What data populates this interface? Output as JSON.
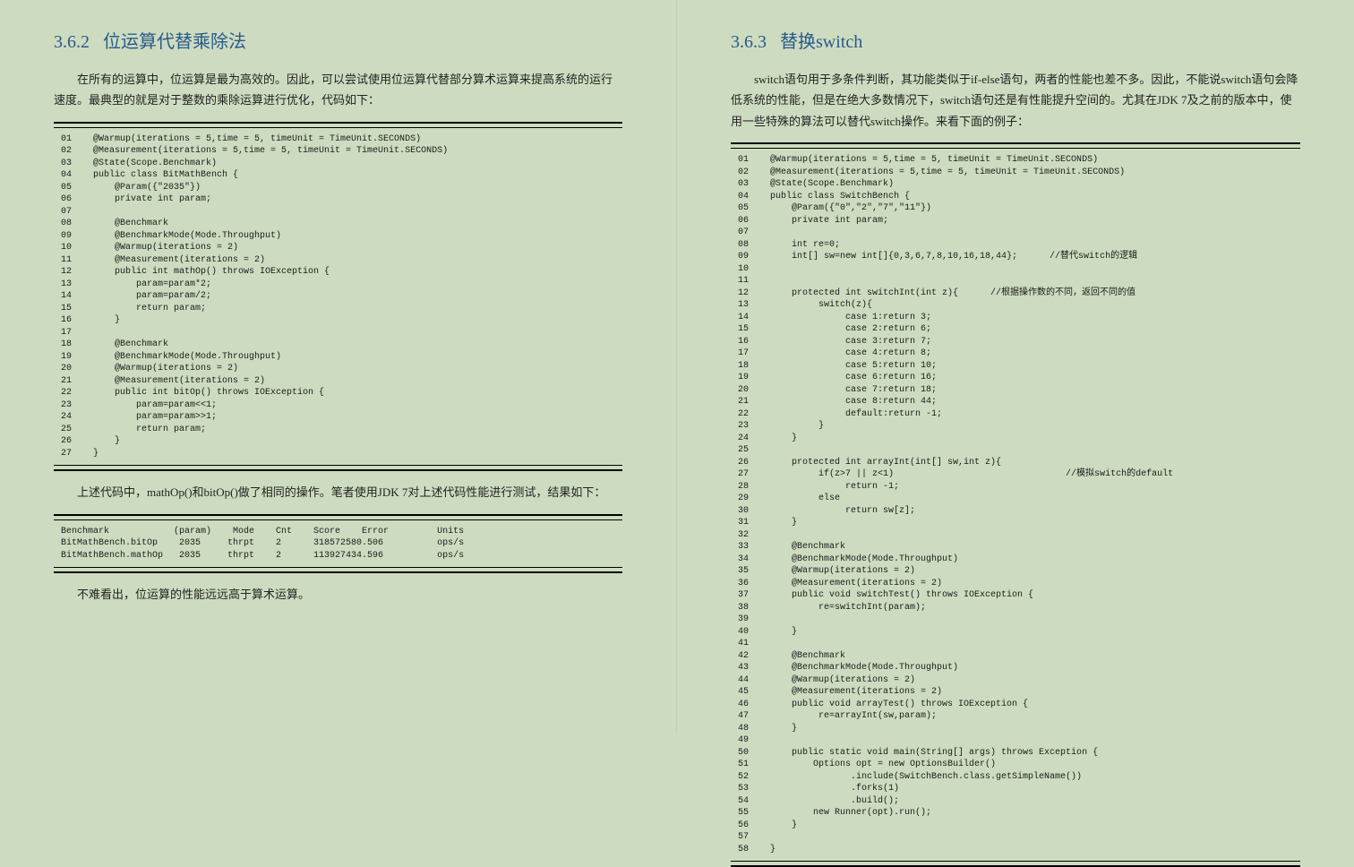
{
  "left": {
    "section_number": "3.6.2",
    "section_title": "位运算代替乘除法",
    "para1": "在所有的运算中，位运算是最为高效的。因此，可以尝试使用位运算代替部分算术运算来提高系统的运行速度。最典型的就是对于整数的乘除运算进行优化，代码如下：",
    "code1": [
      "@Warmup(iterations = 5,time = 5, timeUnit = TimeUnit.SECONDS)",
      "@Measurement(iterations = 5,time = 5, timeUnit = TimeUnit.SECONDS)",
      "@State(Scope.Benchmark)",
      "public class BitMathBench {",
      "    @Param({\"2035\"})",
      "    private int param;",
      "",
      "    @Benchmark",
      "    @BenchmarkMode(Mode.Throughput)",
      "    @Warmup(iterations = 2)",
      "    @Measurement(iterations = 2)",
      "    public int mathOp() throws IOException {",
      "        param=param*2;",
      "        param=param/2;",
      "        return param;",
      "    }",
      "",
      "    @Benchmark",
      "    @BenchmarkMode(Mode.Throughput)",
      "    @Warmup(iterations = 2)",
      "    @Measurement(iterations = 2)",
      "    public int bitOp() throws IOException {",
      "        param=param<<1;",
      "        param=param>>1;",
      "        return param;",
      "    }",
      "}"
    ],
    "para2": "上述代码中，mathOp()和bitOp()做了相同的操作。笔者使用JDK 7对上述代码性能进行测试，结果如下：",
    "results": [
      "Benchmark            (param)    Mode    Cnt    Score    Error         Units",
      "BitMathBench.bitOp    2035     thrpt    2      318572580.506          ops/s",
      "BitMathBench.mathOp   2035     thrpt    2      113927434.596          ops/s"
    ],
    "para3": "不难看出，位运算的性能远远高于算术运算。"
  },
  "right": {
    "section_number": "3.6.3",
    "section_title": "替换switch",
    "para1": "switch语句用于多条件判断，其功能类似于if-else语句，两者的性能也差不多。因此，不能说switch语句会降低系统的性能，但是在绝大多数情况下，switch语句还是有性能提升空间的。尤其在JDK 7及之前的版本中，使用一些特殊的算法可以替代switch操作。来看下面的例子：",
    "code1": [
      "@Warmup(iterations = 5,time = 5, timeUnit = TimeUnit.SECONDS)",
      "@Measurement(iterations = 5,time = 5, timeUnit = TimeUnit.SECONDS)",
      "@State(Scope.Benchmark)",
      "public class SwitchBench {",
      "    @Param({\"0\",\"2\",\"7\",\"11\"})",
      "    private int param;",
      "",
      "    int re=0;",
      "    int[] sw=new int[]{0,3,6,7,8,10,16,18,44};      //替代switch的逻辑",
      "",
      "",
      "    protected int switchInt(int z){      //根据操作数的不同，返回不同的值",
      "         switch(z){",
      "              case 1:return 3;",
      "              case 2:return 6;",
      "              case 3:return 7;",
      "              case 4:return 8;",
      "              case 5:return 10;",
      "              case 6:return 16;",
      "              case 7:return 18;",
      "              case 8:return 44;",
      "              default:return -1;",
      "         }",
      "    }",
      "",
      "    protected int arrayInt(int[] sw,int z){",
      "         if(z>7 || z<1)                                //模拟switch的default",
      "              return -1;",
      "         else",
      "              return sw[z];",
      "    }",
      "",
      "    @Benchmark",
      "    @BenchmarkMode(Mode.Throughput)",
      "    @Warmup(iterations = 2)",
      "    @Measurement(iterations = 2)",
      "    public void switchTest() throws IOException {",
      "         re=switchInt(param);",
      "",
      "    }",
      "",
      "    @Benchmark",
      "    @BenchmarkMode(Mode.Throughput)",
      "    @Warmup(iterations = 2)",
      "    @Measurement(iterations = 2)",
      "    public void arrayTest() throws IOException {",
      "         re=arrayInt(sw,param);",
      "    }",
      "",
      "    public static void main(String[] args) throws Exception {",
      "        Options opt = new OptionsBuilder()",
      "               .include(SwitchBench.class.getSimpleName())",
      "               .forks(1)",
      "               .build();",
      "        new Runner(opt).run();",
      "    }",
      "",
      "}"
    ]
  }
}
